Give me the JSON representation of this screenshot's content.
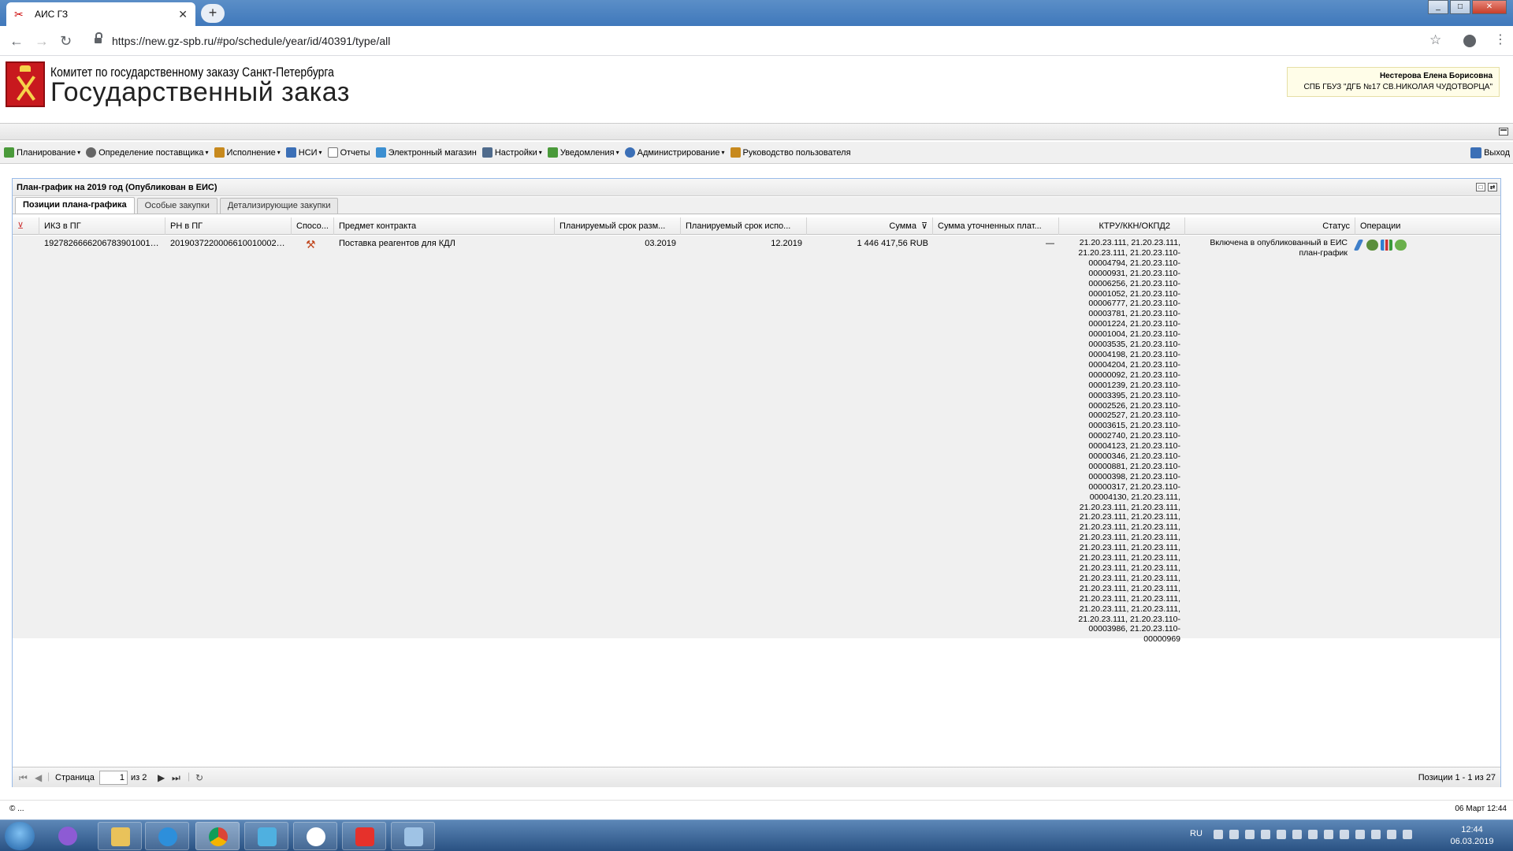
{
  "browser": {
    "tab_title": "АИС ГЗ",
    "new_tab": "+",
    "url": "https://new.gz-spb.ru/#po/schedule/year/id/40391/type/all"
  },
  "header": {
    "org_line": "Комитет по государственному заказу Санкт-Петербурга",
    "app_title": "Государственный заказ",
    "user_name": "Нестерова Елена Борисовна",
    "user_org": "СПБ ГБУЗ \"ДГБ №17 СВ.НИКОЛАЯ ЧУДОТВОРЦА\""
  },
  "menu": {
    "items": [
      {
        "label": "Планирование",
        "icon": "planning-icon",
        "color": "#4a9a3a"
      },
      {
        "label": "Определение поставщика",
        "icon": "gear-icon",
        "color": "#555555"
      },
      {
        "label": "Исполнение",
        "icon": "execution-icon",
        "color": "#c7891d"
      },
      {
        "label": "НСИ",
        "icon": "book-icon",
        "color": "#3b6fb6"
      },
      {
        "label": "Отчеты",
        "icon": "report-icon",
        "color": "#777777"
      },
      {
        "label": "Электронный магазин",
        "icon": "cart-icon",
        "color": "#3c8fd1"
      },
      {
        "label": "Настройки",
        "icon": "wrench-icon",
        "color": "#4f6b8c"
      },
      {
        "label": "Уведомления",
        "icon": "notification-icon",
        "color": "#4a9a3a"
      },
      {
        "label": "Администрирование",
        "icon": "user-icon",
        "color": "#3b6fb6"
      },
      {
        "label": "Руководство пользователя",
        "icon": "manual-icon",
        "color": "#c7891d"
      }
    ],
    "logout": "Выход"
  },
  "panel": {
    "title": "План-график на 2019 год (Опубликован в ЕИС)",
    "tabs": [
      "Позиции плана-графика",
      "Особые закупки",
      "Детализирующие закупки"
    ]
  },
  "grid": {
    "columns": [
      "ИКЗ в ПГ",
      "РН в ПГ",
      "Спосо...",
      "Предмет контракта",
      "Планируемый срок разм...",
      "Планируемый срок испо...",
      "Сумма",
      "Сумма уточненных плат...",
      "КТРУ/ККН/ОКПД2",
      "Статус",
      "Операции"
    ],
    "rows": [
      {
        "ikz": "192782666620678390100100....",
        "rn": "201903722000661001000200....",
        "subject": "Поставка реагентов для КДЛ",
        "plan_place": "03.2019",
        "plan_exec": "12.2019",
        "sum": "1 446 417,56 RUB",
        "sum_refined": "—",
        "ktru": [
          "21.20.23.111, 21.20.23.111,",
          "21.20.23.111, 21.20.23.110-",
          "00004794, 21.20.23.110-",
          "00000931, 21.20.23.110-",
          "00006256, 21.20.23.110-",
          "00001052, 21.20.23.110-",
          "00006777, 21.20.23.110-",
          "00003781, 21.20.23.110-",
          "00001224, 21.20.23.110-",
          "00001004, 21.20.23.110-",
          "00003535, 21.20.23.110-",
          "00004198, 21.20.23.110-",
          "00004204, 21.20.23.110-",
          "00000092, 21.20.23.110-",
          "00001239, 21.20.23.110-",
          "00003395, 21.20.23.110-",
          "00002526, 21.20.23.110-",
          "00002527, 21.20.23.110-",
          "00003615, 21.20.23.110-",
          "00002740, 21.20.23.110-",
          "00004123, 21.20.23.110-",
          "00000346, 21.20.23.110-",
          "00000881, 21.20.23.110-",
          "00000398, 21.20.23.110-",
          "00000317, 21.20.23.110-",
          "00004130, 21.20.23.111,",
          "21.20.23.111, 21.20.23.111,",
          "21.20.23.111, 21.20.23.111,",
          "21.20.23.111, 21.20.23.111,",
          "21.20.23.111, 21.20.23.111,",
          "21.20.23.111, 21.20.23.111,",
          "21.20.23.111, 21.20.23.111,",
          "21.20.23.111, 21.20.23.111,",
          "21.20.23.111, 21.20.23.111,",
          "21.20.23.111, 21.20.23.111,",
          "21.20.23.111, 21.20.23.111,",
          "21.20.23.111, 21.20.23.111,",
          "21.20.23.111, 21.20.23.110-",
          "00003986, 21.20.23.110-",
          "00000969"
        ],
        "status": [
          "Включена в опубликованный в ЕИС",
          "план-график"
        ]
      }
    ]
  },
  "pager": {
    "page_label": "Страница",
    "page_value": "1",
    "of_label": "из 2",
    "positions": "Позиции 1 - 1 из 27"
  },
  "footer": {
    "left": "© ...",
    "datetime": "06 Март 12:44"
  },
  "taskbar": {
    "lang": "RU",
    "time": "12:44",
    "date": "06.03.2019"
  }
}
